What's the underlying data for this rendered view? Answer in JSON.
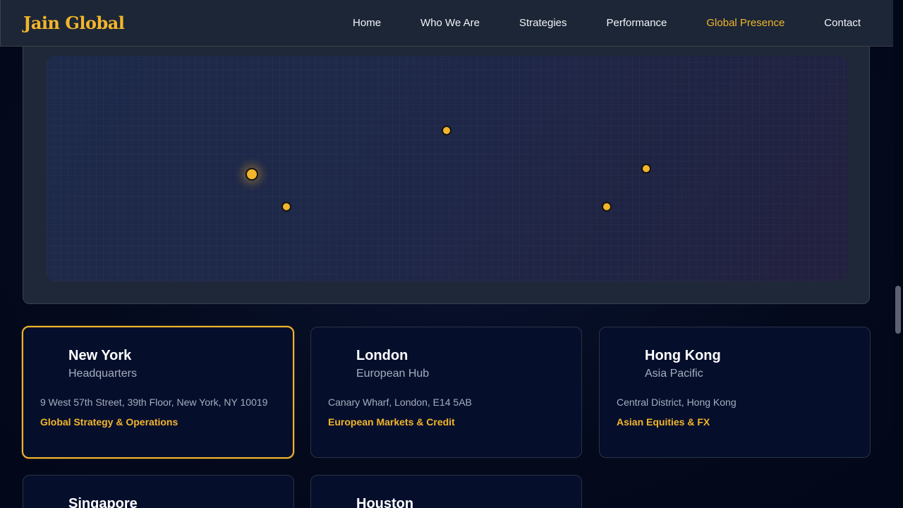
{
  "brand": "Jain Global",
  "nav": {
    "items": [
      {
        "label": "Home",
        "active": false
      },
      {
        "label": "Who We Are",
        "active": false
      },
      {
        "label": "Strategies",
        "active": false
      },
      {
        "label": "Performance",
        "active": false
      },
      {
        "label": "Global Presence",
        "active": true
      },
      {
        "label": "Contact",
        "active": false
      }
    ]
  },
  "colors": {
    "accent": "#f3b52b",
    "background": "#030b1f",
    "card": "#050f2c",
    "muted_text": "#a6adbd"
  },
  "map": {
    "pins": [
      {
        "office": "New York",
        "hq": true
      },
      {
        "office": "Houston",
        "hq": false
      },
      {
        "office": "London",
        "hq": false
      },
      {
        "office": "Hong Kong",
        "hq": false
      },
      {
        "office": "Singapore",
        "hq": false
      }
    ]
  },
  "offices": [
    {
      "city": "New York",
      "role": "Headquarters",
      "address": "9 West 57th Street, 39th Floor, New York, NY 10019",
      "focus": "Global Strategy & Operations",
      "selected": true
    },
    {
      "city": "London",
      "role": "European Hub",
      "address": "Canary Wharf, London, E14 5AB",
      "focus": "European Markets & Credit",
      "selected": false
    },
    {
      "city": "Hong Kong",
      "role": "Asia Pacific",
      "address": "Central District, Hong Kong",
      "focus": "Asian Equities & FX",
      "selected": false
    },
    {
      "city": "Singapore",
      "role": "",
      "address": "",
      "focus": "",
      "selected": false
    },
    {
      "city": "Houston",
      "role": "",
      "address": "",
      "focus": "",
      "selected": false
    }
  ]
}
